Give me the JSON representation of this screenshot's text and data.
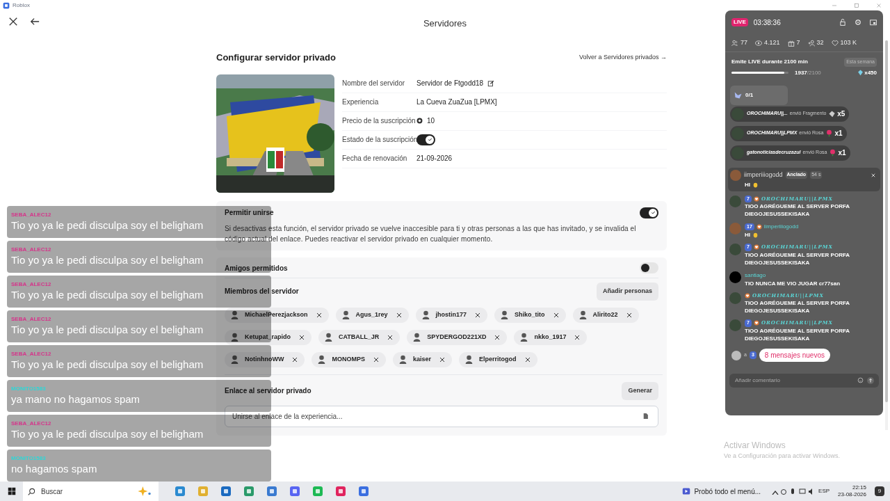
{
  "window": {
    "title": "Roblox"
  },
  "header": {
    "title": "Servidores"
  },
  "page": {
    "title": "Configurar servidor privado",
    "back_link": "Volver a Servidores privados →",
    "details": [
      {
        "kind": "text",
        "label": "Nombre del servidor",
        "value": "Servidor de Ftgodd18",
        "editable": true
      },
      {
        "kind": "text",
        "label": "Experiencia",
        "value": "La Cueva ZuaZua [LPMX]"
      },
      {
        "kind": "price",
        "label": "Precio de la suscripción",
        "value": "10"
      },
      {
        "kind": "toggle",
        "label": "Estado de la suscripción",
        "on": true
      },
      {
        "kind": "text",
        "label": "Fecha de renovación",
        "value": "21-09-2026"
      }
    ],
    "allow_join": {
      "title": "Permitir unirse",
      "on": true,
      "description": "Si desactivas esta función, el servidor privado se vuelve inaccesible para ti y otras personas a las que has invitado, y se invalida el código actual del enlace. Puedes reactivar el servidor privado en cualquier momento."
    },
    "friends_allowed": {
      "title": "Amigos permitidos",
      "on": false
    },
    "members": {
      "title": "Miembros del servidor",
      "button": "Añadir personas",
      "items": [
        {
          "name": "MichaelPerezjackson"
        },
        {
          "name": "Agus_1rey"
        },
        {
          "name": "jhostin177"
        },
        {
          "name": "Shiko_tito"
        },
        {
          "name": "Alirito22"
        },
        {
          "name": "Ketupat_rapido"
        },
        {
          "name": "CATBALL_JR"
        },
        {
          "name": "SPYDERGOD221XD"
        },
        {
          "name": "nkko_1917"
        },
        {
          "name": "NotinhnoWW"
        },
        {
          "name": "MONOMPS"
        },
        {
          "name": "kaiser"
        },
        {
          "name": "Elperritogod"
        }
      ]
    },
    "link": {
      "title": "Enlace al servidor privado",
      "button": "Generar",
      "placeholder": "Unirse al enlace de la experiencia..."
    }
  },
  "overlay_chat": [
    {
      "user": "SEBA_ALEC12",
      "color": "#d6338a",
      "text": "Tio yo ya le pedi disculpa soy el beligham"
    },
    {
      "user": "SEBA_ALEC12",
      "color": "#d6338a",
      "text": "Tio yo ya le pedi disculpa soy el beligham"
    },
    {
      "user": "SEBA_ALEC12",
      "color": "#d6338a",
      "text": "Tio yo ya le pedi disculpa soy el beligham"
    },
    {
      "user": "SEBA_ALEC12",
      "color": "#d6338a",
      "text": "Tio yo ya le pedi disculpa soy el beligham"
    },
    {
      "user": "SEBA_ALEC12",
      "color": "#d6338a",
      "text": "Tio yo ya le pedi disculpa soy el beligham"
    },
    {
      "user": "MONITO1583",
      "color": "#2fd6d6",
      "text": "ya mano no hagamos spam"
    },
    {
      "user": "SEBA_ALEC12",
      "color": "#d6338a",
      "text": "Tio yo ya le pedi disculpa soy el beligham"
    },
    {
      "user": "MONITO1583",
      "color": "#2fd6d6",
      "text": "no hagamos spam"
    }
  ],
  "live": {
    "badge": "LIVE",
    "timer": "03:38:36",
    "stats": [
      {
        "kind": "viewers",
        "value": "77"
      },
      {
        "kind": "views",
        "value": "4.121"
      },
      {
        "kind": "gifts",
        "value": "7"
      },
      {
        "kind": "followers",
        "value": "32"
      },
      {
        "kind": "likes",
        "value": "103 K"
      }
    ],
    "goal": {
      "title": "Emite LIVE durante 2100 min",
      "period": "Esta semana",
      "level": 0.922,
      "current": "1937",
      "target": "/2100",
      "reward": "x450"
    },
    "task": "0/1",
    "gifts": [
      {
        "user": "OROCHIMARU||...",
        "action": "envió Fragmento",
        "count": "x5",
        "kind": "fragment"
      },
      {
        "user": "OROCHIMARU||LPMX",
        "action": "envió Rosa",
        "count": "x1",
        "kind": "rose"
      },
      {
        "user": "gatonoticiasdecruzazul",
        "action": "envió Rosa",
        "count": "x1",
        "kind": "rose"
      }
    ],
    "pinned": {
      "user": "iimperiiiogodd",
      "tag": "Anclado",
      "time": "54 s",
      "text": "HI"
    },
    "messages": [
      {
        "user": "OROCHIMARU||LPMX",
        "level": "7",
        "fan": true,
        "fancy": true,
        "text": "TIOO AGRÉGUEME AL SERVER PORFA DIEGOJESUSSEKISAKA",
        "wave": false
      },
      {
        "user": "iimperiiiogodd",
        "level": "17",
        "fan": true,
        "fancy": false,
        "text": "HI",
        "wave": true
      },
      {
        "user": "OROCHIMARU||LPMX",
        "level": "7",
        "fan": true,
        "fancy": true,
        "text": "TIOO AGRÉGUEME AL SERVER PORFA DIEGOJESUSSEKISAKA",
        "wave": false
      },
      {
        "user": "santiago",
        "fan": false,
        "fancy": false,
        "text": "TIO NUNCA ME VIO JUGAR cr77san",
        "wave": false
      },
      {
        "user": "OROCHIMARU||LPMX",
        "fan": true,
        "fancy": true,
        "text": "TIOO AGRÉGUEME AL SERVER PORFA DIEGOJESUSSEKISAKA",
        "wave": false
      },
      {
        "user": "OROCHIMARU||LPMX",
        "level": "7",
        "fan": true,
        "fancy": true,
        "text": "TIOO AGRÉGUEME AL SERVER PORFA DIEGOJESUSSEKISAKA",
        "wave": false
      }
    ],
    "partial": {
      "user": "a",
      "level": "3"
    },
    "new_messages": "8 mensajes nuevos",
    "comment_placeholder": "Añadir comentario"
  },
  "activation": {
    "title": "Activar Windows",
    "text": "Ve a Configuración para activar Windows."
  },
  "taskbar": {
    "search": "Buscar",
    "notification": "Probó todo el menú...",
    "language": "ESP",
    "time": "22:15",
    "date": "23-08-2026",
    "badge": "9"
  }
}
